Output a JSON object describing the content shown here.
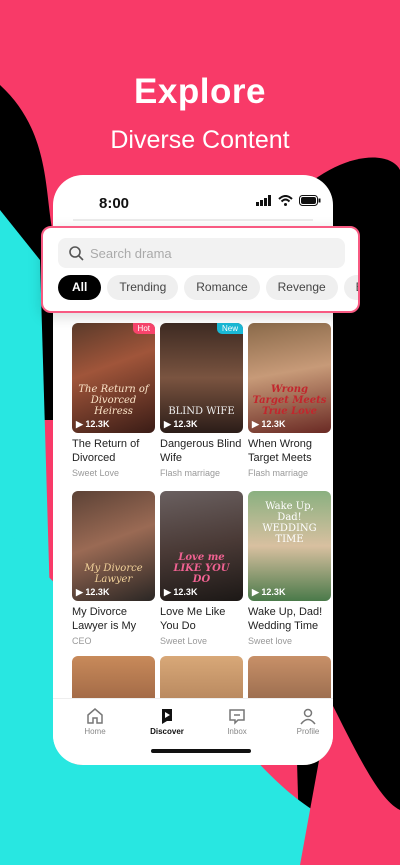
{
  "headline": {
    "title": "Explore",
    "subtitle": "Diverse Content"
  },
  "status": {
    "time": "8:00"
  },
  "search": {
    "placeholder": "Search drama"
  },
  "chips": [
    "All",
    "Trending",
    "Romance",
    "Revenge",
    "Betr"
  ],
  "cards": [
    {
      "title": "The Return of Divorced Heiress",
      "subtitle": "Sweet Love",
      "views": "12.3K",
      "badge": "Hot",
      "poster_text": "The Return of Divorced Heiress"
    },
    {
      "title": "Dangerous Blind Wife",
      "subtitle": "Flash marriage",
      "views": "12.3K",
      "badge": "New",
      "poster_text": "BLIND WIFE"
    },
    {
      "title": "When Wrong Target Meets Tr...",
      "subtitle": "Flash marriage",
      "views": "12.3K",
      "badge": "",
      "poster_text": "Wrong Target Meets True Love"
    },
    {
      "title": "My Divorce Lawyer is My Hu...",
      "subtitle": "CEO",
      "views": "12.3K",
      "badge": "",
      "poster_text": "My Divorce Lawyer"
    },
    {
      "title": "Love Me Like You Do",
      "subtitle": "Sweet Love",
      "views": "12.3K",
      "badge": "",
      "poster_text": "Love me LIKE YOU DO"
    },
    {
      "title": "Wake Up, Dad! Wedding Time",
      "subtitle": "Sweet love",
      "views": "12.3K",
      "badge": "",
      "poster_text": "Wake Up, Dad! WEDDING TIME"
    },
    {
      "title": "",
      "subtitle": "",
      "views": "",
      "badge": "",
      "poster_text": ""
    },
    {
      "title": "",
      "subtitle": "",
      "views": "",
      "badge": "",
      "poster_text": ""
    },
    {
      "title": "",
      "subtitle": "",
      "views": "",
      "badge": "",
      "poster_text": ""
    }
  ],
  "nav": {
    "home": "Home",
    "discover": "Discover",
    "inbox": "Inbox",
    "profile": "Profile"
  },
  "colors": {
    "brand": "#f83a68",
    "accent_black": "#000000",
    "cyan": "#27e6e0",
    "hot": "#f8446c",
    "new": "#1ab9d6"
  }
}
